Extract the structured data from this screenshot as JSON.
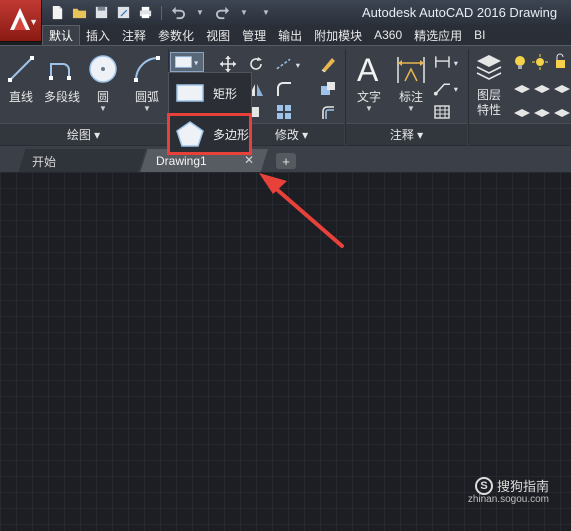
{
  "window": {
    "title": "Autodesk AutoCAD 2016   Drawing"
  },
  "ribbon_tabs": [
    "默认",
    "插入",
    "注释",
    "参数化",
    "视图",
    "管理",
    "输出",
    "附加模块",
    "A360",
    "精选应用",
    "BI"
  ],
  "draw_panel": {
    "tools": [
      {
        "label": "直线",
        "icon": "line-icon"
      },
      {
        "label": "多段线",
        "icon": "polyline-icon"
      },
      {
        "label": "圆",
        "icon": "circle-icon"
      },
      {
        "label": "圆弧",
        "icon": "arc-icon"
      }
    ],
    "footer": "绘图 ▾"
  },
  "modify_panel": {
    "footer": "修改 ▾"
  },
  "annotation_panel": {
    "tools": [
      {
        "label": "文字",
        "icon": "text-icon"
      },
      {
        "label": "标注",
        "icon": "dimension-icon"
      }
    ],
    "footer": "注释 ▾"
  },
  "layers_panel": {
    "tool": {
      "label_line1": "图层",
      "label_line2": "特性",
      "icon": "layer-properties-icon"
    }
  },
  "flyout": {
    "items": [
      {
        "label": "矩形",
        "icon": "rectangle-icon"
      },
      {
        "label": "多边形",
        "icon": "polygon-icon",
        "highlighted": true
      }
    ]
  },
  "file_tabs": [
    {
      "label": "开始",
      "active": false
    },
    {
      "label": "Drawing1",
      "active": true
    }
  ],
  "watermark": {
    "brand": "搜狗指南",
    "site": "zhinan.sogou.com"
  },
  "colors": {
    "highlight": "#e8413a",
    "arrow": "#e8413a",
    "app_button": "#b0302a"
  }
}
